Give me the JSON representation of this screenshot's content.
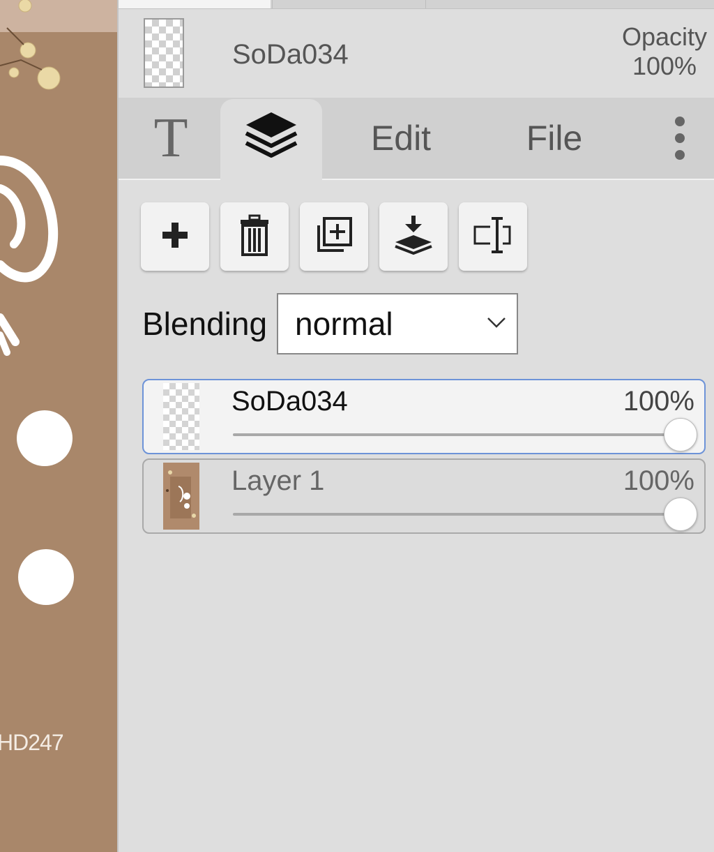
{
  "canvas": {
    "watermark": "HD247"
  },
  "layer_header": {
    "name": "SoDa034",
    "opacity_label": "Opacity",
    "opacity_value": "100%"
  },
  "tabs": {
    "text_glyph": "T",
    "edit": "Edit",
    "file": "File"
  },
  "actions": [
    {
      "icon": "plus-icon"
    },
    {
      "icon": "trash-icon"
    },
    {
      "icon": "duplicate-icon"
    },
    {
      "icon": "merge-down-icon"
    },
    {
      "icon": "rename-icon"
    }
  ],
  "blending": {
    "label": "Blending",
    "value": "normal"
  },
  "layers": [
    {
      "name": "SoDa034",
      "opacity": "100%",
      "opacity_fraction": 1.0,
      "active": true
    },
    {
      "name": "Layer 1",
      "opacity": "100%",
      "opacity_fraction": 1.0,
      "active": false
    }
  ],
  "colors": {
    "accent": "#6d93d8",
    "canvas_bg": "#a9876a",
    "panel_bg": "#dedede"
  }
}
